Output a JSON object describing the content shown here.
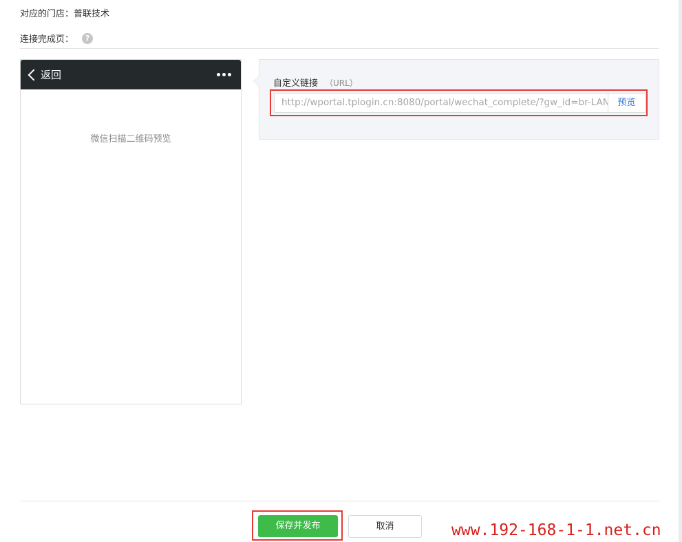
{
  "store": {
    "label": "对应的门店：",
    "value": "普联技术"
  },
  "complete_page": {
    "label": "连接完成页：",
    "help_icon": "question-circle-icon"
  },
  "phone_preview": {
    "back_label": "返回",
    "back_icon": "chevron-left-icon",
    "menu_icon": "more-dots-icon",
    "placeholder": "微信扫描二维码预览"
  },
  "custom_link": {
    "label": "自定义链接",
    "hint": "（URL）",
    "url": "http://wportal.tplogin.cn:8080/portal/wechat_complete/?gw_id=br-LAN",
    "preview_label": "预览"
  },
  "footer": {
    "save_label": "保存并发布",
    "cancel_label": "取消"
  },
  "watermark": "www.192-168-1-1.net.cn",
  "colors": {
    "save_green": "#3fbb4a",
    "highlight_red": "#e53935",
    "phone_header": "#24292b",
    "link_blue": "#3a7bd5",
    "watermark_red": "#d8201d"
  }
}
